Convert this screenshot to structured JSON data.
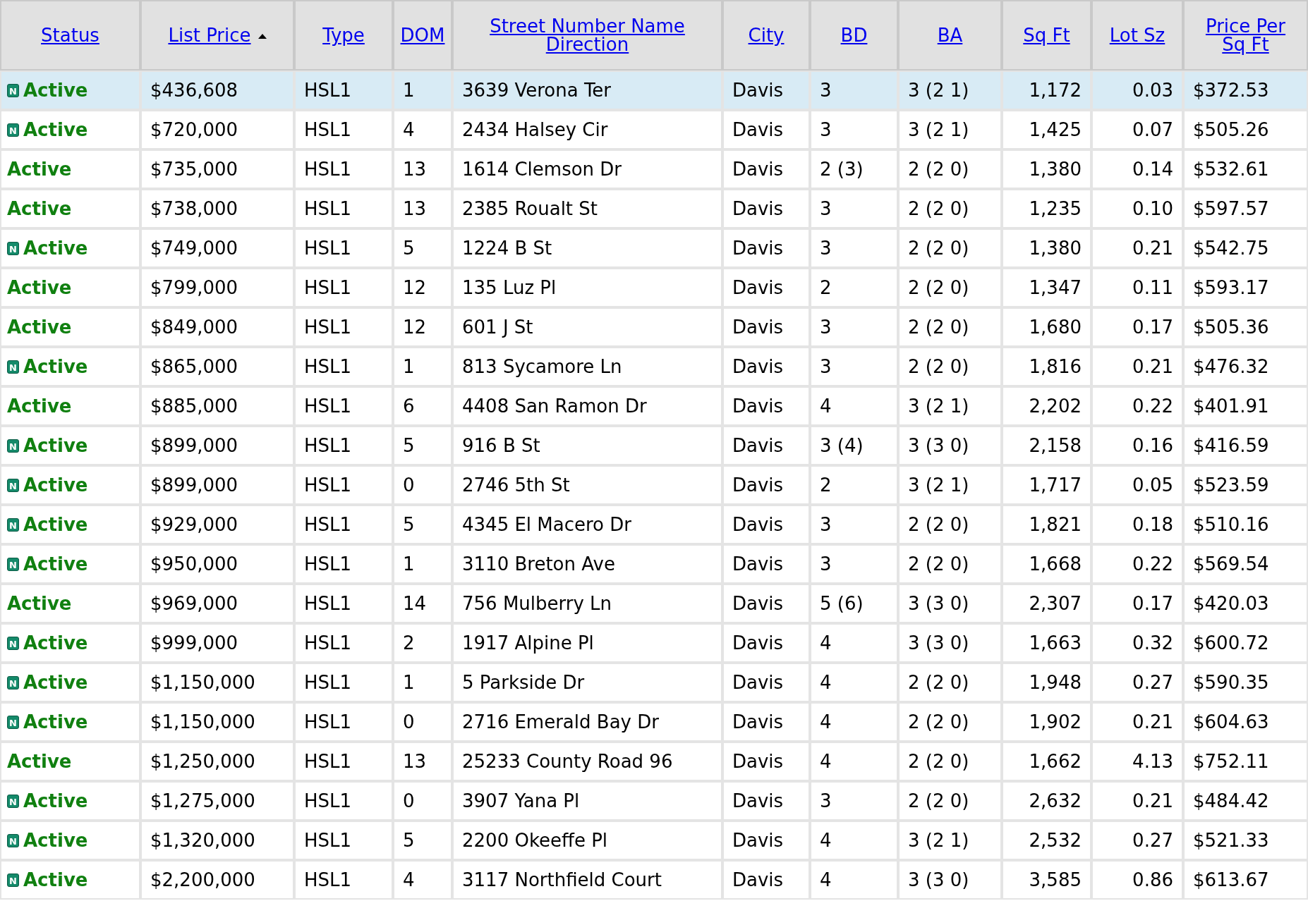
{
  "table": {
    "columns": [
      {
        "label": "Status",
        "sorted": false
      },
      {
        "label": "List Price",
        "sorted": true
      },
      {
        "label": "Type",
        "sorted": false
      },
      {
        "label": "DOM",
        "sorted": false
      },
      {
        "label": "Street Number Name Direction",
        "sorted": false
      },
      {
        "label": "City",
        "sorted": false
      },
      {
        "label": "BD",
        "sorted": false
      },
      {
        "label": "BA",
        "sorted": false
      },
      {
        "label": "Sq Ft",
        "sorted": false
      },
      {
        "label": "Lot Sz",
        "sorted": false
      },
      {
        "label": "Price Per Sq Ft",
        "sorted": false
      }
    ],
    "rows": [
      {
        "selected": true,
        "new_badge": "N",
        "cells": [
          "Active",
          "$436,608",
          "HSL1",
          "1",
          "3639 Verona Ter",
          "Davis",
          "3",
          "3 (2 1)",
          "1,172",
          "0.03",
          "$372.53"
        ]
      },
      {
        "selected": false,
        "new_badge": "N",
        "cells": [
          "Active",
          "$720,000",
          "HSL1",
          "4",
          "2434 Halsey Cir",
          "Davis",
          "3",
          "3 (2 1)",
          "1,425",
          "0.07",
          "$505.26"
        ]
      },
      {
        "selected": false,
        "cells": [
          "Active",
          "$735,000",
          "HSL1",
          "13",
          "1614 Clemson Dr",
          "Davis",
          "2 (3)",
          "2 (2 0)",
          "1,380",
          "0.14",
          "$532.61"
        ]
      },
      {
        "selected": false,
        "cells": [
          "Active",
          "$738,000",
          "HSL1",
          "13",
          "2385 Roualt St",
          "Davis",
          "3",
          "2 (2 0)",
          "1,235",
          "0.10",
          "$597.57"
        ]
      },
      {
        "selected": false,
        "new_badge": "N",
        "cells": [
          "Active",
          "$749,000",
          "HSL1",
          "5",
          "1224 B St",
          "Davis",
          "3",
          "2 (2 0)",
          "1,380",
          "0.21",
          "$542.75"
        ]
      },
      {
        "selected": false,
        "cells": [
          "Active",
          "$799,000",
          "HSL1",
          "12",
          "135 Luz Pl",
          "Davis",
          "2",
          "2 (2 0)",
          "1,347",
          "0.11",
          "$593.17"
        ]
      },
      {
        "selected": false,
        "cells": [
          "Active",
          "$849,000",
          "HSL1",
          "12",
          "601 J St",
          "Davis",
          "3",
          "2 (2 0)",
          "1,680",
          "0.17",
          "$505.36"
        ]
      },
      {
        "selected": false,
        "new_badge": "N",
        "cells": [
          "Active",
          "$865,000",
          "HSL1",
          "1",
          "813 Sycamore Ln",
          "Davis",
          "3",
          "2 (2 0)",
          "1,816",
          "0.21",
          "$476.32"
        ]
      },
      {
        "selected": false,
        "cells": [
          "Active",
          "$885,000",
          "HSL1",
          "6",
          "4408 San Ramon Dr",
          "Davis",
          "4",
          "3 (2 1)",
          "2,202",
          "0.22",
          "$401.91"
        ]
      },
      {
        "selected": false,
        "new_badge": "N",
        "cells": [
          "Active",
          "$899,000",
          "HSL1",
          "5",
          "916 B St",
          "Davis",
          "3 (4)",
          "3 (3 0)",
          "2,158",
          "0.16",
          "$416.59"
        ]
      },
      {
        "selected": false,
        "new_badge": "N",
        "cells": [
          "Active",
          "$899,000",
          "HSL1",
          "0",
          "2746 5th St",
          "Davis",
          "2",
          "3 (2 1)",
          "1,717",
          "0.05",
          "$523.59"
        ]
      },
      {
        "selected": false,
        "new_badge": "N",
        "cells": [
          "Active",
          "$929,000",
          "HSL1",
          "5",
          "4345 El Macero Dr",
          "Davis",
          "3",
          "2 (2 0)",
          "1,821",
          "0.18",
          "$510.16"
        ]
      },
      {
        "selected": false,
        "new_badge": "N",
        "cells": [
          "Active",
          "$950,000",
          "HSL1",
          "1",
          "3110 Breton Ave",
          "Davis",
          "3",
          "2 (2 0)",
          "1,668",
          "0.22",
          "$569.54"
        ]
      },
      {
        "selected": false,
        "cells": [
          "Active",
          "$969,000",
          "HSL1",
          "14",
          "756 Mulberry Ln",
          "Davis",
          "5 (6)",
          "3 (3 0)",
          "2,307",
          "0.17",
          "$420.03"
        ]
      },
      {
        "selected": false,
        "new_badge": "N",
        "cells": [
          "Active",
          "$999,000",
          "HSL1",
          "2",
          "1917 Alpine Pl",
          "Davis",
          "4",
          "3 (3 0)",
          "1,663",
          "0.32",
          "$600.72"
        ]
      },
      {
        "selected": false,
        "new_badge": "N",
        "cells": [
          "Active",
          "$1,150,000",
          "HSL1",
          "1",
          "5 Parkside Dr",
          "Davis",
          "4",
          "2 (2 0)",
          "1,948",
          "0.27",
          "$590.35"
        ]
      },
      {
        "selected": false,
        "new_badge": "N",
        "cells": [
          "Active",
          "$1,150,000",
          "HSL1",
          "0",
          "2716 Emerald Bay Dr",
          "Davis",
          "4",
          "2 (2 0)",
          "1,902",
          "0.21",
          "$604.63"
        ]
      },
      {
        "selected": false,
        "cells": [
          "Active",
          "$1,250,000",
          "HSL1",
          "13",
          "25233 County Road 96",
          "Davis",
          "4",
          "2 (2 0)",
          "1,662",
          "4.13",
          "$752.11"
        ]
      },
      {
        "selected": false,
        "new_badge": "N",
        "cells": [
          "Active",
          "$1,275,000",
          "HSL1",
          "0",
          "3907 Yana Pl",
          "Davis",
          "3",
          "2 (2 0)",
          "2,632",
          "0.21",
          "$484.42"
        ]
      },
      {
        "selected": false,
        "new_badge": "N",
        "cells": [
          "Active",
          "$1,320,000",
          "HSL1",
          "5",
          "2200 Okeeffe Pl",
          "Davis",
          "4",
          "3 (2 1)",
          "2,532",
          "0.27",
          "$521.33"
        ]
      },
      {
        "selected": false,
        "new_badge": "N",
        "cells": [
          "Active",
          "$2,200,000",
          "HSL1",
          "4",
          "3117 Northfield Court",
          "Davis",
          "4",
          "3 (3 0)",
          "3,585",
          "0.86",
          "$613.67"
        ]
      }
    ]
  }
}
